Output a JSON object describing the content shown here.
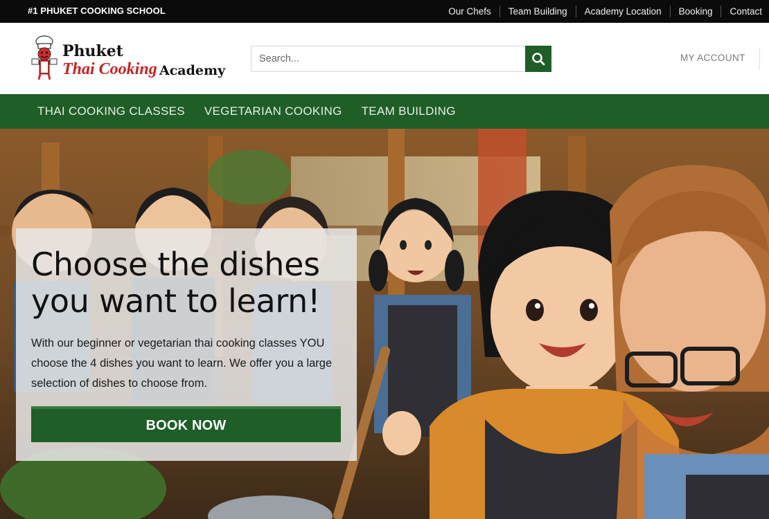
{
  "topbar": {
    "tagline": "#1 PHUKET COOKING SCHOOL",
    "links": [
      "Our Chefs",
      "Team Building",
      "Academy Location",
      "Booking",
      "Contact"
    ]
  },
  "logo": {
    "line1": "Phuket",
    "line2": "Thai Cooking",
    "line3": "Academy"
  },
  "search": {
    "placeholder": "Search...",
    "icon": "search-icon"
  },
  "account": {
    "label": "MY ACCOUNT"
  },
  "nav": {
    "items": [
      "THAI COOKING CLASSES",
      "VEGETARIAN COOKING",
      "TEAM BUILDING"
    ]
  },
  "hero": {
    "heading": "Choose the dishes you want to learn!",
    "body": "With our beginner or vegetarian thai cooking classes YOU choose the 4 dishes you want to learn. We offer you a large selection of dishes to choose from.",
    "cta": "BOOK NOW"
  },
  "colors": {
    "brand_green": "#1f5e27",
    "topbar_bg": "#0b0b0b",
    "logo_red": "#cc1f1f"
  }
}
